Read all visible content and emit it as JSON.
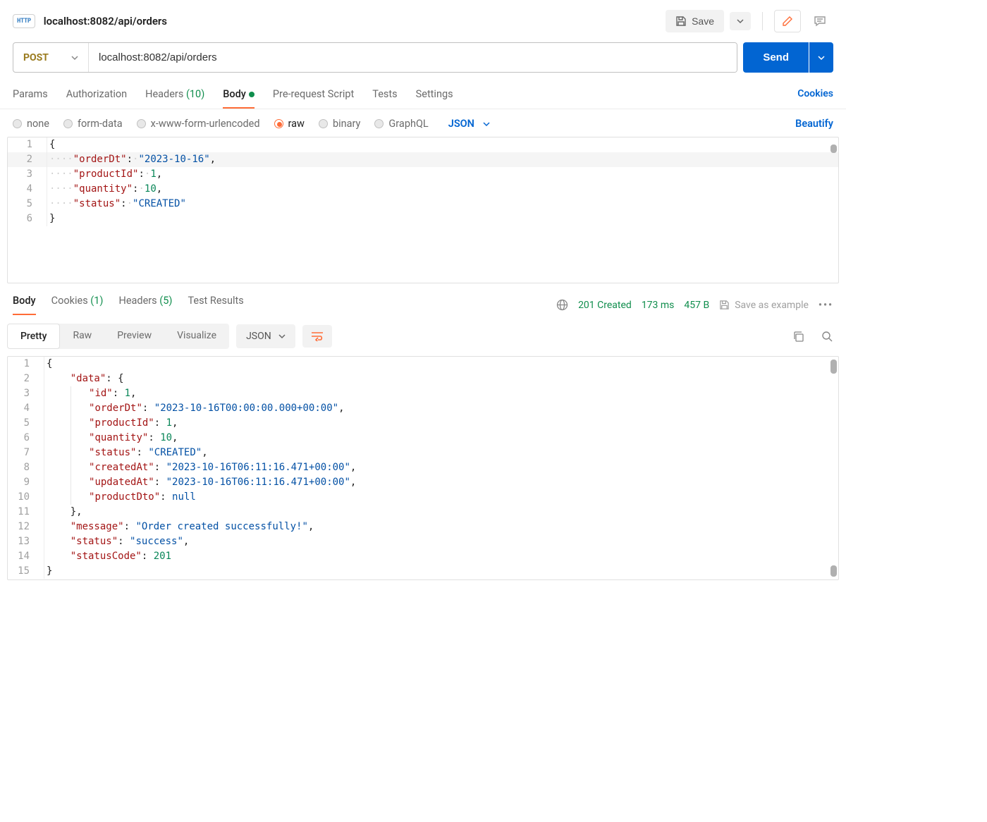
{
  "header": {
    "http_badge": "HTTP",
    "title": "localhost:8082/api/orders",
    "save_label": "Save"
  },
  "request": {
    "method": "POST",
    "url": "localhost:8082/api/orders",
    "send_label": "Send"
  },
  "req_tabs": {
    "params": "Params",
    "authorization": "Authorization",
    "headers": "Headers",
    "headers_count": "(10)",
    "body": "Body",
    "prerequest": "Pre-request Script",
    "tests": "Tests",
    "settings": "Settings",
    "cookies": "Cookies"
  },
  "body_type": {
    "none": "none",
    "form_data": "form-data",
    "urlencoded": "x-www-form-urlencoded",
    "raw": "raw",
    "binary": "binary",
    "graphql": "GraphQL",
    "json": "JSON",
    "beautify": "Beautify"
  },
  "req_body_lines": [
    "1",
    "2",
    "3",
    "4",
    "5",
    "6"
  ],
  "req_body_json": {
    "orderDt": "2023-10-16",
    "productId": 1,
    "quantity": 10,
    "status": "CREATED"
  },
  "resp_tabs": {
    "body": "Body",
    "cookies": "Cookies",
    "cookies_count": "(1)",
    "headers": "Headers",
    "headers_count": "(5)",
    "test_results": "Test Results"
  },
  "resp_meta": {
    "status": "201 Created",
    "time": "173 ms",
    "size": "457 B",
    "save_example": "Save as example"
  },
  "resp_view": {
    "pretty": "Pretty",
    "raw": "Raw",
    "preview": "Preview",
    "visualize": "Visualize",
    "format": "JSON"
  },
  "resp_body_lines": [
    "1",
    "2",
    "3",
    "4",
    "5",
    "6",
    "7",
    "8",
    "9",
    "10",
    "11",
    "12",
    "13",
    "14",
    "15"
  ],
  "resp_body_json": {
    "data": {
      "id": 1,
      "orderDt": "2023-10-16T00:00:00.000+00:00",
      "productId": 1,
      "quantity": 10,
      "status": "CREATED",
      "createdAt": "2023-10-16T06:11:16.471+00:00",
      "updatedAt": "2023-10-16T06:11:16.471+00:00",
      "productDto": null
    },
    "message": "Order created successfully!",
    "status": "success",
    "statusCode": 201
  }
}
